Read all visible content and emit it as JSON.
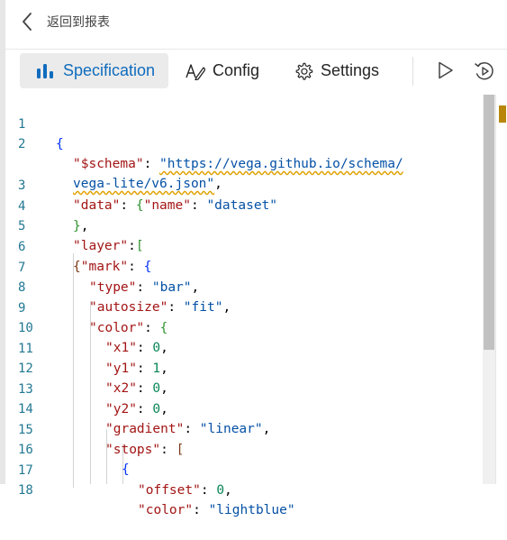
{
  "header": {
    "back_label": "返回到报表",
    "back_icon": "chevron-left-icon"
  },
  "toolbar": {
    "tabs": [
      {
        "label": "Specification",
        "icon": "bar-chart-icon",
        "active": true
      },
      {
        "label": "Config",
        "icon": "text-edit-icon",
        "active": false
      },
      {
        "label": "Settings",
        "icon": "gear-icon",
        "active": false
      }
    ],
    "actions": [
      {
        "name": "run",
        "icon": "play-icon"
      },
      {
        "name": "auto-run",
        "icon": "play-circle-icon"
      }
    ]
  },
  "editor": {
    "language": "json",
    "lines": [
      {
        "number": "1",
        "text": "{"
      },
      {
        "number": "2",
        "text": "\"$schema\": \"https://vega.github.io/schema/"
      },
      {
        "number": "",
        "text": "vega-lite/v6.json\","
      },
      {
        "number": "3",
        "text": "\"data\": {\"name\": \"dataset\""
      },
      {
        "number": "4",
        "text": "},"
      },
      {
        "number": "5",
        "text": "\"layer\":["
      },
      {
        "number": "6",
        "text": "{\"mark\": {"
      },
      {
        "number": "7",
        "text": "\"type\": \"bar\","
      },
      {
        "number": "8",
        "text": "\"autosize\": \"fit\","
      },
      {
        "number": "9",
        "text": "\"color\": {"
      },
      {
        "number": "10",
        "text": "\"x1\": 0,"
      },
      {
        "number": "11",
        "text": "\"y1\": 1,"
      },
      {
        "number": "12",
        "text": "\"x2\": 0,"
      },
      {
        "number": "13",
        "text": "\"y2\": 0,"
      },
      {
        "number": "14",
        "text": "\"gradient\": \"linear\","
      },
      {
        "number": "15",
        "text": "\"stops\": ["
      },
      {
        "number": "16",
        "text": "{"
      },
      {
        "number": "17",
        "text": "\"offset\": 0,"
      },
      {
        "number": "18",
        "text": "\"color\": \"lightblue\""
      }
    ]
  },
  "colors": {
    "accent": "#0f6cbd",
    "line_number": "#237893",
    "json_key": "#a31515",
    "json_string": "#0451a5",
    "json_number": "#098658",
    "warning_squiggle": "#e0a000"
  }
}
